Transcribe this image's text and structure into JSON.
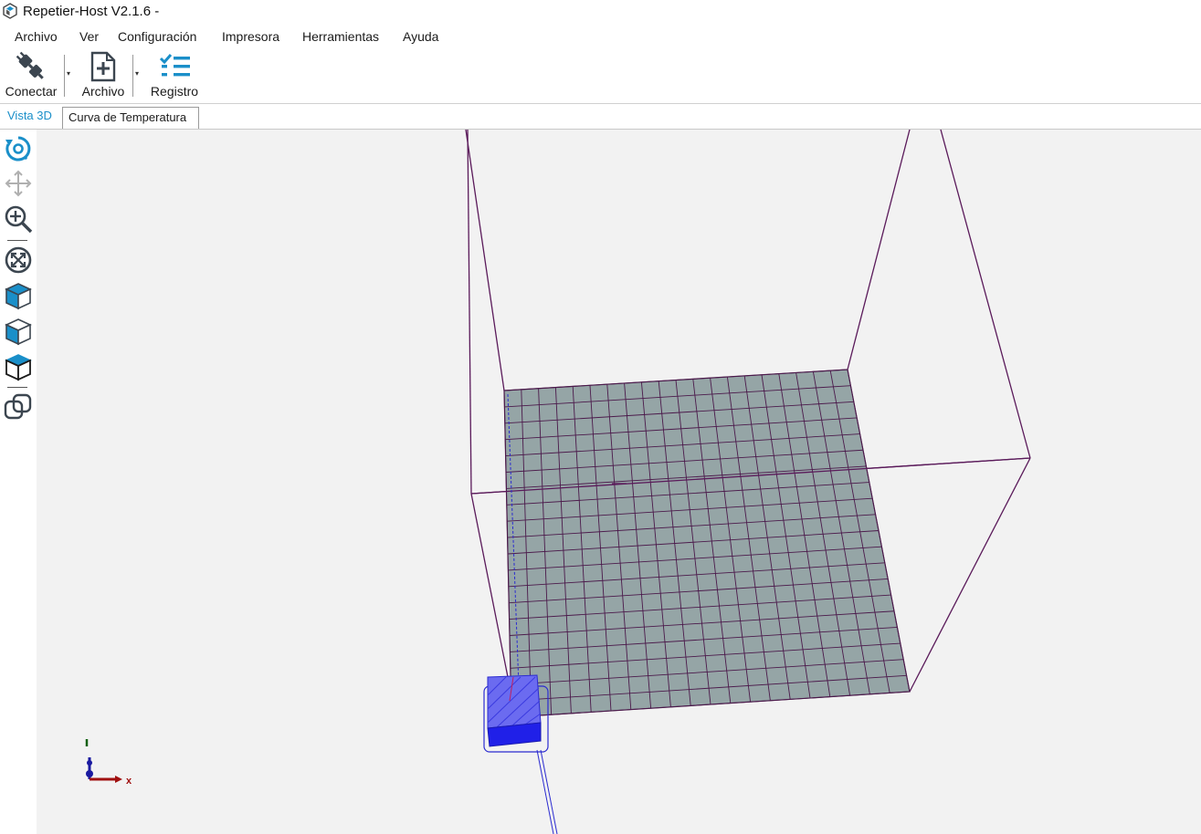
{
  "window": {
    "title": "Repetier-Host V2.1.6 -",
    "icon": "repetier-logo-icon"
  },
  "menu": {
    "items": [
      "Archivo",
      "Ver",
      "Configuración",
      "Impresora",
      "Herramientas",
      "Ayuda"
    ]
  },
  "toolbar": {
    "connect_label": "Conectar",
    "connect_icon": "plug-icon",
    "file_label": "Archivo",
    "file_icon": "file-add-icon",
    "log_label": "Registro",
    "log_icon": "checklist-icon"
  },
  "tabs": {
    "view3d_label": "Vista 3D",
    "temp_curve_label": "Curva de Temperatura"
  },
  "side_tools": {
    "icons": [
      "rotate-view-icon",
      "move-view-icon",
      "zoom-icon",
      "fit-view-icon",
      "iso-view-icon",
      "front-view-icon",
      "top-view-icon",
      "parallel-projection-icon"
    ]
  },
  "viewport": {
    "axis_x_label": "x",
    "colors": {
      "background": "#f2f2f2",
      "bed": "#95a5a6",
      "bed_grid": "#4b1a4b",
      "build_volume": "#5a1a5a",
      "object": "#3a3ae0",
      "axis_x": "#a01010",
      "axis_y": "#106010",
      "axis_z": "#1a1aa0"
    }
  },
  "accent_color": "#1a8fc9"
}
